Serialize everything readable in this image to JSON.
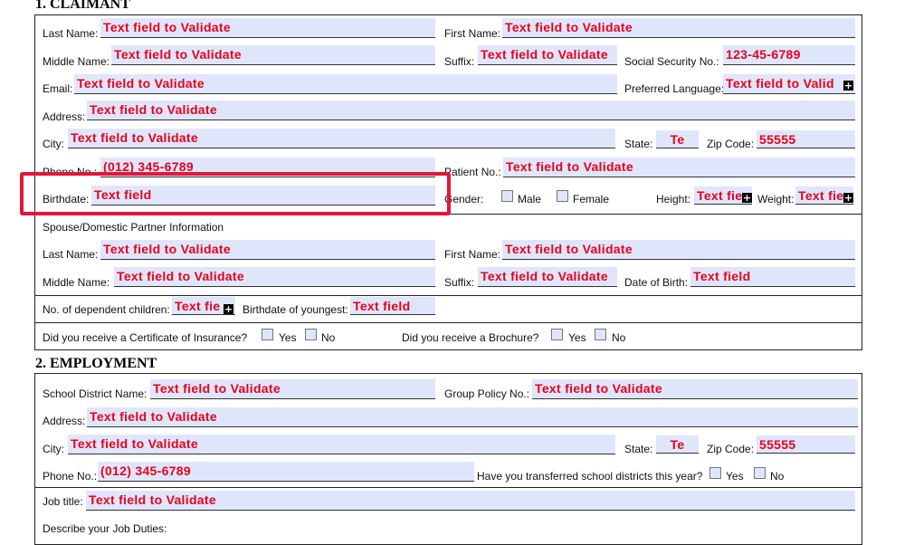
{
  "claimant": {
    "title": "1. CLAIMANT",
    "last_name_label": "Last Name:",
    "last_name_value": "Text field to Validate",
    "first_name_label": "First Name:",
    "first_name_value": "Text field to Validate",
    "middle_name_label": "Middle Name:",
    "middle_name_value": "Text field to Validate",
    "suffix_label": "Suffix:",
    "suffix_value": "Text field to Validate",
    "ssn_label": "Social Security No.:",
    "ssn_value": "123-45-6789",
    "email_label": "Email:",
    "email_value": "Text field to Validate",
    "pref_lang_label": "Preferred Language:",
    "pref_lang_value": "Text field to Valid",
    "address_label": "Address:",
    "address_value": "Text field to Validate",
    "city_label": "City:",
    "city_value": "Text field to Validate",
    "state_label": "State:",
    "state_value": "Te",
    "zip_label": "Zip Code:",
    "zip_value": "55555",
    "phone_label": "Phone No.:",
    "phone_value": "(012) 345-6789",
    "patient_label": "Patient No.:",
    "patient_value": "Text field to Validate",
    "birthdate_label": "Birthdate:",
    "birthdate_value": "Text field",
    "gender_label": "Gender:",
    "male_label": "Male",
    "female_label": "Female",
    "height_label": "Height:",
    "height_value": "Text fie",
    "weight_label": "Weight:",
    "weight_value": "Text fie",
    "spouse_heading": "Spouse/Domestic Partner Information",
    "sp_last_label": "Last Name:",
    "sp_last_value": "Text field to Validate",
    "sp_first_label": "First Name:",
    "sp_first_value": "Text field to Validate",
    "sp_middle_label": "Middle Name:",
    "sp_middle_value": "Text field to Validate",
    "sp_suffix_label": "Suffix:",
    "sp_suffix_value": "Text field to Validate",
    "sp_dob_label": "Date of Birth:",
    "sp_dob_value": "Text field",
    "dep_label": "No. of dependent children:",
    "dep_value": "Text fie",
    "youngest_label": "Birthdate of youngest:",
    "youngest_value": "Text field",
    "cert_question": "Did you receive a Certificate of Insurance?",
    "brochure_question": "Did you receive a Brochure?",
    "yes_label": "Yes",
    "no_label": "No"
  },
  "employment": {
    "title": "2. EMPLOYMENT",
    "school_label": "School District Name:",
    "school_value": "Text field to Validate",
    "group_label": "Group Policy No.:",
    "group_value": "Text field to Validate",
    "address_label": "Address:",
    "address_value": "Text field to Validate",
    "city_label": "City:",
    "city_value": "Text field to Validate",
    "state_label": "State:",
    "state_value": "Te",
    "zip_label": "Zip Code:",
    "zip_value": "55555",
    "phone_label": "Phone No.:",
    "phone_value": "(012) 345-6789",
    "transfer_question": "Have you transferred school districts this year?",
    "yes_label": "Yes",
    "no_label": "No",
    "job_title_label": "Job title:",
    "job_title_value": "Text field to Validate",
    "duties_label": "Describe your Job Duties:"
  },
  "colors": {
    "field_bg": "#dfe6fb",
    "field_text": "#e8001c",
    "highlight": "#e0173b"
  },
  "icons": {
    "overflow_indicator": "plus-box-icon"
  }
}
